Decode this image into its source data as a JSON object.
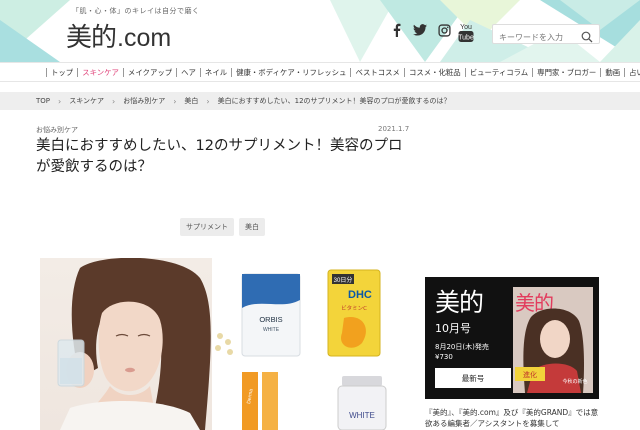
{
  "header": {
    "tagline": "「肌・心・体」のキレイは自分で磨く",
    "logo_kanji": "美的",
    "logo_com": ".com",
    "search_placeholder": "キーワードを入力",
    "youtube_label": "You Tube"
  },
  "nav": {
    "items": [
      {
        "label": "トップ",
        "active": false
      },
      {
        "label": "スキンケア",
        "active": true
      },
      {
        "label": "メイクアップ",
        "active": false
      },
      {
        "label": "ヘア",
        "active": false
      },
      {
        "label": "ネイル",
        "active": false
      },
      {
        "label": "健康・ボディケア・リフレッシュ",
        "active": false
      },
      {
        "label": "ベストコスメ",
        "active": false
      },
      {
        "label": "コスメ・化粧品",
        "active": false
      },
      {
        "label": "ビューティコラム",
        "active": false
      },
      {
        "label": "専門家・ブロガー",
        "active": false
      },
      {
        "label": "動画",
        "active": false
      },
      {
        "label": "占い",
        "active": false
      }
    ]
  },
  "breadcrumb": [
    "TOP",
    "スキンケア",
    "お悩み別ケア",
    "美白",
    "美白におすすめしたい、12のサプリメント！美容のプロが愛飲するのは？"
  ],
  "article": {
    "category": "お悩み別ケア",
    "date": "2021.1.7",
    "title": "美白におすすめしたい、12のサプリメント！美容のプロが愛飲するのは？",
    "tags": [
      "サプリメント",
      "美白"
    ]
  },
  "products": {
    "orbis_brand": "ORBIS",
    "orbis_sub": "WHITE",
    "dhc_brand": "DHC",
    "dhc_days": "30日分",
    "dhc_name": "ビタミンC",
    "stick_label": "Derma",
    "bottle_label": "WHITE"
  },
  "ad": {
    "logo": "美的",
    "issue": "10月号",
    "release": "8月20日(木)発売",
    "price": "¥730",
    "button": "最新号",
    "cover_title": "美的",
    "cover_tag": "進化",
    "cover_sub": "今秋の新色",
    "text": "『美的』、『美的.com』及び『美的GRAND』では意欲ある編集者／アシスタントを募集して"
  },
  "colors": {
    "accent": "#e0457b",
    "header_teal": "#9fdad6",
    "header_mint": "#cdeee3",
    "ad_bg": "#111111"
  }
}
